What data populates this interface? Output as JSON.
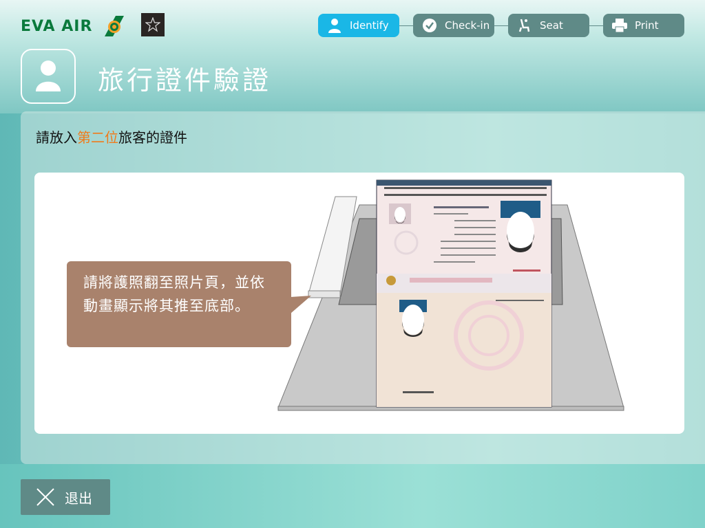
{
  "brand": {
    "logo_text": "EVA AIR",
    "alliance_logo": "star-alliance-logo"
  },
  "steps": [
    {
      "label": "Identify",
      "icon": "person-icon",
      "active": true
    },
    {
      "label": "Check-in",
      "icon": "checkmark-icon",
      "active": false
    },
    {
      "label": "Seat",
      "icon": "seat-icon",
      "active": false
    },
    {
      "label": "Print",
      "icon": "printer-icon",
      "active": false
    }
  ],
  "page": {
    "title": "旅行證件驗證",
    "title_icon": "person-icon"
  },
  "instruction": {
    "prefix": "請放入",
    "highlight": "第二位",
    "suffix": "旅客的證件"
  },
  "tooltip": {
    "text": "請將護照翻至照片頁，並依動畫顯示將其推至底部。"
  },
  "exit": {
    "label": "退出",
    "icon": "close-icon"
  },
  "colors": {
    "active_step": "#1ab7e6",
    "inactive_step": "#5f8a87",
    "highlight": "#f07a1a",
    "bubble": "#a9826c"
  }
}
